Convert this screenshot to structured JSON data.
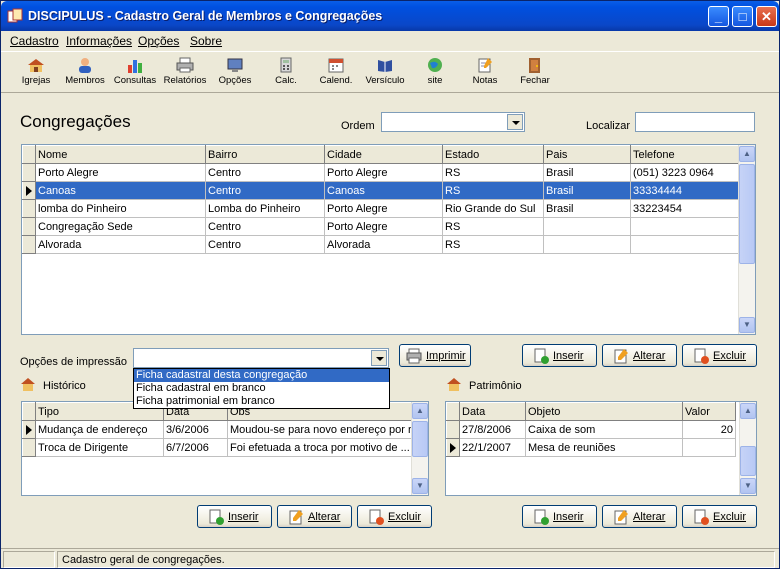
{
  "window": {
    "title": "DISCIPULUS - Cadastro Geral de Membros e Congregações"
  },
  "menu": [
    "Cadastro",
    "Informações",
    "Opções",
    "Sobre"
  ],
  "toolbar": [
    {
      "label": "Igrejas",
      "icon": "church-icon"
    },
    {
      "label": "Membros",
      "icon": "members-icon"
    },
    {
      "label": "Consultas",
      "icon": "chart-icon"
    },
    {
      "label": "Relatórios",
      "icon": "printer-icon"
    },
    {
      "label": "Opções",
      "icon": "computer-icon"
    },
    {
      "label": "Calc.",
      "icon": "calculator-icon"
    },
    {
      "label": "Calend.",
      "icon": "calendar-icon"
    },
    {
      "label": "Versículo",
      "icon": "book-icon"
    },
    {
      "label": "site",
      "icon": "globe-icon"
    },
    {
      "label": "Notas",
      "icon": "notepad-icon"
    },
    {
      "label": "Fechar",
      "icon": "exit-door-icon"
    }
  ],
  "page_title": "Congregações",
  "order_label": "Ordem",
  "search_label": "Localizar",
  "congregations": {
    "columns": [
      "Nome",
      "Bairro",
      "Cidade",
      "Estado",
      "Pais",
      "Telefone"
    ],
    "rows": [
      [
        "Porto Alegre",
        "Centro",
        "Porto Alegre",
        "RS",
        "Brasil",
        "(051) 3223 0964"
      ],
      [
        "Canoas",
        "Centro",
        "Canoas",
        "RS",
        "Brasil",
        "33334444"
      ],
      [
        "lomba do Pinheiro",
        "Lomba do Pinheiro",
        "Porto Alegre",
        "Rio Grande do Sul",
        "Brasil",
        "33223454"
      ],
      [
        "Congregação Sede",
        "Centro",
        "Porto Alegre",
        "RS",
        "",
        ""
      ],
      [
        "Alvorada",
        "Centro",
        "Alvorada",
        "RS",
        "",
        ""
      ]
    ],
    "selected_row": 1
  },
  "print": {
    "label": "Opções de impressão",
    "button": "Imprimir",
    "options": [
      "Ficha cadastral desta congregação",
      "Ficha cadastral em branco",
      "Ficha patrimonial em branco"
    ],
    "highlighted_option": 0
  },
  "buttons": {
    "insert": "Inserir",
    "edit": "Alterar",
    "delete": "Excluir"
  },
  "history": {
    "title": "Histórico",
    "columns": [
      "Tipo",
      "Data",
      "Obs"
    ],
    "rows": [
      [
        "Mudança de endereço",
        "3/6/2006",
        "Moudou-se para novo endereço por r"
      ],
      [
        "Troca de Dirigente",
        "6/7/2006",
        "Foi efetuada a troca por motivo de ..."
      ]
    ],
    "selected_row": 0
  },
  "patrimony": {
    "title": "Patrimônio",
    "columns": [
      "Data",
      "Objeto",
      "Valor"
    ],
    "rows": [
      [
        "27/8/2006",
        "Caixa de som",
        "20"
      ],
      [
        "22/1/2007",
        "Mesa de reuniões",
        ""
      ]
    ],
    "selected_row": 1
  },
  "status": "Cadastro geral de congregações."
}
